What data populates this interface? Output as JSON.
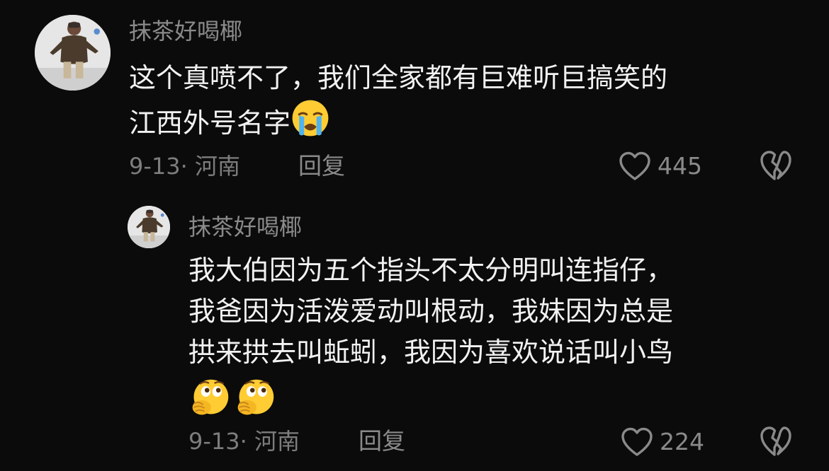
{
  "comments": [
    {
      "username": "抹茶好喝椰",
      "avatar": "user-avatar-photo",
      "lines": [
        "这个真喷不了，我们全家都有巨难听巨搞笑的",
        "江西外号名字"
      ],
      "emoji": "loudly-crying-face-emoji",
      "date_location": "9-13· 河南",
      "reply_label": "回复",
      "like_count": "445",
      "like_icon": "heart-outline-icon",
      "dislike_icon": "broken-heart-icon"
    },
    {
      "username": "抹茶好喝椰",
      "avatar": "user-avatar-photo",
      "lines": [
        "我大伯因为五个指头不太分明叫连指仔，",
        "我爸因为活泼爱动叫根动，我妹因为总是",
        "拱来拱去叫蚯蚓，我因为喜欢说话叫小鸟"
      ],
      "emojis": [
        "face-with-hand-over-mouth-emoji",
        "face-with-hand-over-mouth-emoji"
      ],
      "date_location": "9-13· 河南",
      "reply_label": "回复",
      "like_count": "224",
      "like_icon": "heart-outline-icon",
      "dislike_icon": "broken-heart-icon"
    }
  ]
}
